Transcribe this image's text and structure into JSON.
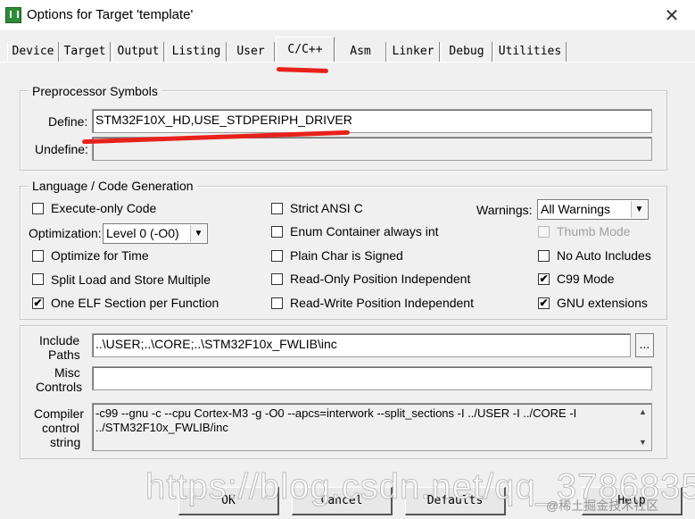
{
  "window": {
    "title": "Options for Target 'template'",
    "close_glyph": "✕"
  },
  "tabs": [
    {
      "label": "Device"
    },
    {
      "label": "Target"
    },
    {
      "label": "Output"
    },
    {
      "label": "Listing"
    },
    {
      "label": "User"
    },
    {
      "label": "C/C++",
      "active": true
    },
    {
      "label": "Asm"
    },
    {
      "label": "Linker"
    },
    {
      "label": "Debug"
    },
    {
      "label": "Utilities"
    }
  ],
  "preprocessor": {
    "group_title": "Preprocessor Symbols",
    "define_label": "Define:",
    "define_value": "STM32F10X_HD,USE_STDPERIPH_DRIVER",
    "undefine_label": "Undefine:",
    "undefine_value": ""
  },
  "codegen": {
    "group_title": "Language / Code Generation",
    "execute_only": {
      "label": "Execute-only Code",
      "checked": false
    },
    "optimization_label": "Optimization:",
    "optimization_value": "Level 0 (-O0)",
    "optimize_time": {
      "label": "Optimize for Time",
      "checked": false
    },
    "split_load": {
      "label": "Split Load and Store Multiple",
      "checked": false
    },
    "one_elf": {
      "label": "One ELF Section per Function",
      "checked": true
    },
    "strict_ansi": {
      "label": "Strict ANSI C",
      "checked": false
    },
    "enum_container": {
      "label": "Enum Container always int",
      "checked": false
    },
    "plain_char": {
      "label": "Plain Char is Signed",
      "checked": false
    },
    "ro_pos": {
      "label": "Read-Only Position Independent",
      "checked": false
    },
    "rw_pos": {
      "label": "Read-Write Position Independent",
      "checked": false
    },
    "warnings_label": "Warnings:",
    "warnings_value": "All Warnings",
    "thumb_mode": {
      "label": "Thumb Mode",
      "checked": false,
      "disabled": true
    },
    "no_auto_includes": {
      "label": "No Auto Includes",
      "checked": false
    },
    "c99_mode": {
      "label": "C99 Mode",
      "checked": true
    },
    "gnu_ext": {
      "label": "GNU extensions",
      "checked": true
    }
  },
  "paths": {
    "include_label_1": "Include",
    "include_label_2": "Paths",
    "include_value": "..\\USER;..\\CORE;..\\STM32F10x_FWLIB\\inc",
    "browse_label": "...",
    "misc_label_1": "Misc",
    "misc_label_2": "Controls",
    "misc_value": "",
    "compiler_label_1": "Compiler",
    "compiler_label_2": "control",
    "compiler_label_3": "string",
    "compiler_line_1": "-c99 --gnu -c --cpu Cortex-M3 -g -O0 --apcs=interwork --split_sections -I ../USER -I ../CORE -I",
    "compiler_line_2": "../STM32F10x_FWLIB/inc"
  },
  "buttons": {
    "ok": "OK",
    "cancel": "Cancel",
    "defaults": "Defaults",
    "help": "Help"
  },
  "checkmark": "✔",
  "colors": {
    "annotation_red": "#e8211a",
    "checked_box_background": "#ffffff"
  },
  "watermark": {
    "url": "https://blog.csdn.net/qq_37868356",
    "site": "@稀土掘金技术社区"
  },
  "icons": {
    "app": "keil-uvision-icon",
    "close": "close-icon",
    "dropdown": "chevron-down-icon",
    "scroll_up": "scroll-up-icon",
    "scroll_down": "scroll-down-icon"
  }
}
